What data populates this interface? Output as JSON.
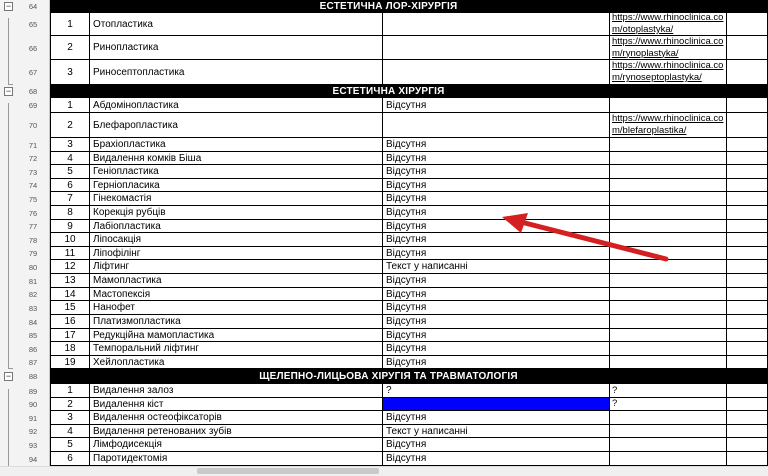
{
  "sections": [
    {
      "title": "ЕСТЕТИЧНА ЛОР-ХІРУРГІЯ",
      "row_no": "64"
    },
    {
      "title": "ЕСТЕТИЧНА ХІРУРГІЯ",
      "row_no": "68"
    },
    {
      "title": "ЩЕЛЕПНО-ЛИЦЬОВА ХІРУГІЯ ТА ТРАВМАТОЛОГІЯ",
      "row_no": "88"
    }
  ],
  "rows": [
    {
      "row_no": "65",
      "num": "1",
      "name": "Отопластика",
      "status": "",
      "url1": "https://www.rhinoclinica.co",
      "url2": "m/otoplastyka/"
    },
    {
      "row_no": "66",
      "num": "2",
      "name": "Ринопластика",
      "status": "",
      "url1": "https://www.rhinoclinica.co",
      "url2": "m/rynoplastyka/"
    },
    {
      "row_no": "67",
      "num": "3",
      "name": "Риносептопластика",
      "status": "",
      "url1": "https://www.rhinoclinica.co",
      "url2": "m/rynoseptoplastyka/"
    },
    {
      "row_no": "69",
      "num": "1",
      "name": "Абдомінопластика",
      "status": "Відсутня",
      "url1": "",
      "url2": ""
    },
    {
      "row_no": "70",
      "num": "2",
      "name": "Блефаропластика",
      "status": "",
      "url1": "https://www.rhinoclinica.co",
      "url2": "m/blefaroplastika/"
    },
    {
      "row_no": "71",
      "num": "3",
      "name": "Брахіопластика",
      "status": "Відсутня",
      "url1": "",
      "url2": ""
    },
    {
      "row_no": "72",
      "num": "4",
      "name": "Видалення комків Біша",
      "status": "Відсутня",
      "url1": "",
      "url2": ""
    },
    {
      "row_no": "73",
      "num": "5",
      "name": "Геніопластика",
      "status": "Відсутня",
      "url1": "",
      "url2": ""
    },
    {
      "row_no": "74",
      "num": "6",
      "name": "Герніопласика",
      "status": "Відсутня",
      "url1": "",
      "url2": ""
    },
    {
      "row_no": "75",
      "num": "7",
      "name": "Гінекомастія",
      "status": "Відсутня",
      "url1": "",
      "url2": ""
    },
    {
      "row_no": "76",
      "num": "8",
      "name": "Корекція рубців",
      "status": "Відсутня",
      "url1": "",
      "url2": ""
    },
    {
      "row_no": "77",
      "num": "9",
      "name": "Лабіопластика",
      "status": "Відсутня",
      "url1": "",
      "url2": ""
    },
    {
      "row_no": "78",
      "num": "10",
      "name": "Ліпосакція",
      "status": "Відсутня",
      "url1": "",
      "url2": ""
    },
    {
      "row_no": "79",
      "num": "11",
      "name": "Ліпофілінг",
      "status": "Відсутня",
      "url1": "",
      "url2": ""
    },
    {
      "row_no": "80",
      "num": "12",
      "name": "Ліфтинг",
      "status": "Текст у написанні",
      "url1": "",
      "url2": ""
    },
    {
      "row_no": "81",
      "num": "13",
      "name": "Мамопластика",
      "status": "Відсутня",
      "url1": "",
      "url2": ""
    },
    {
      "row_no": "82",
      "num": "14",
      "name": "Мастопексія",
      "status": "Відсутня",
      "url1": "",
      "url2": ""
    },
    {
      "row_no": "83",
      "num": "15",
      "name": "Нанофет",
      "status": "Відсутня",
      "url1": "",
      "url2": ""
    },
    {
      "row_no": "84",
      "num": "16",
      "name": "Платизмопластика",
      "status": "Відсутня",
      "url1": "",
      "url2": ""
    },
    {
      "row_no": "85",
      "num": "17",
      "name": "Редукційна мамопластика",
      "status": "Відсутня",
      "url1": "",
      "url2": ""
    },
    {
      "row_no": "86",
      "num": "18",
      "name": "Темпоральний ліфтинг",
      "status": "Відсутня",
      "url1": "",
      "url2": ""
    },
    {
      "row_no": "87",
      "num": "19",
      "name": "Хейлопластика",
      "status": "Відсутня",
      "url1": "",
      "url2": ""
    },
    {
      "row_no": "89",
      "num": "1",
      "name": "Видалення залоз",
      "status": "?",
      "url1": "?",
      "url2": ""
    },
    {
      "row_no": "90",
      "num": "2",
      "name": "Видалення кіст",
      "status": "",
      "url1": "?",
      "url2": "",
      "status_fill": "#0000ff"
    },
    {
      "row_no": "91",
      "num": "3",
      "name": "Видалення остеофіксаторів",
      "status": "Відсутня",
      "url1": "",
      "url2": ""
    },
    {
      "row_no": "92",
      "num": "4",
      "name": "Видалення ретенованих зубів",
      "status": "Текст у написанні",
      "url1": "",
      "url2": ""
    },
    {
      "row_no": "93",
      "num": "5",
      "name": "Лімфодисекція",
      "status": "Відсутня",
      "url1": "",
      "url2": ""
    },
    {
      "row_no": "94",
      "num": "6",
      "name": "Паротидектомія",
      "status": "Відсутня",
      "url1": "",
      "url2": ""
    }
  ],
  "collapse_symbol": "−",
  "colors": {
    "header_bg": "#000000",
    "header_fg": "#ffffff",
    "highlight": "#0000ff",
    "arrow": "#d42020"
  }
}
